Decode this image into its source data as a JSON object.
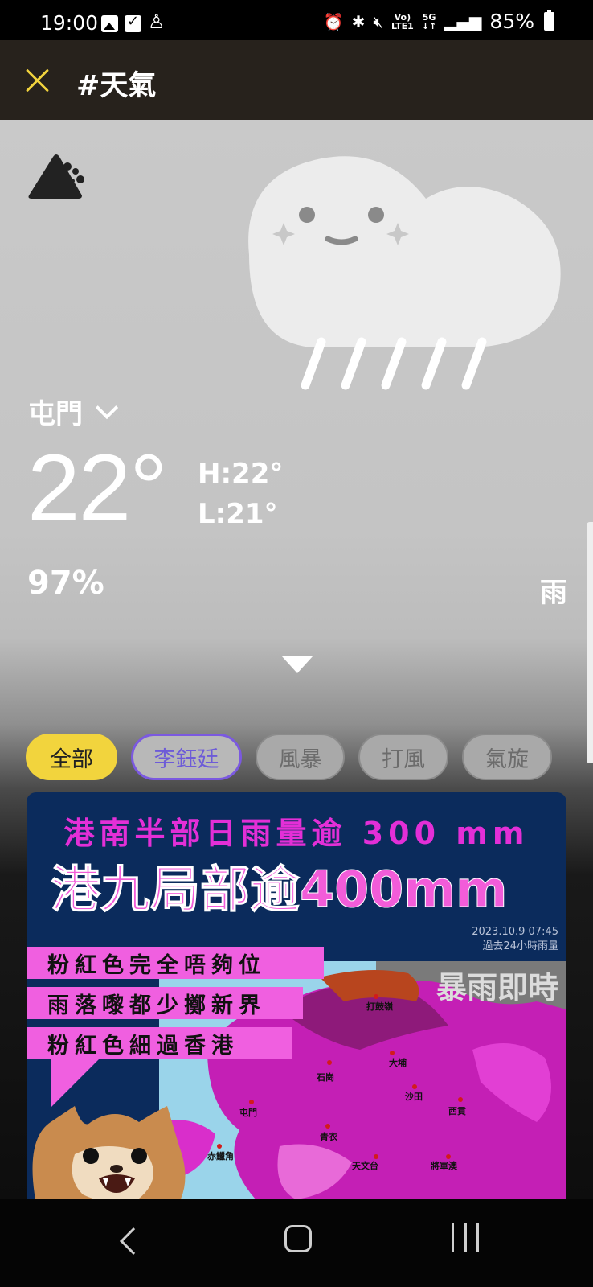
{
  "status_bar": {
    "time": "19:00",
    "lte_top": "Vo)",
    "lte_bottom": "LTE1",
    "net_top": "5G",
    "net_bottom": "↓↑",
    "battery": "85%"
  },
  "header": {
    "title": "#天氣"
  },
  "weather": {
    "location": "屯門",
    "temperature": "22°",
    "high": "H:22°",
    "low": "L:21°",
    "humidity": "97%",
    "condition": "雨"
  },
  "tags": [
    {
      "label": "全部"
    },
    {
      "label": "李鈺廷"
    },
    {
      "label": "風暴"
    },
    {
      "label": "打風"
    },
    {
      "label": "氣旋"
    }
  ],
  "card": {
    "headline1": "港南半部日雨量逾 300 mm",
    "headline2": "港九局部逾400mm",
    "timestamp_line1": "2023.10.9 07:45",
    "timestamp_line2": "過去24小時雨量",
    "caption_lines": [
      "粉紅色完全唔夠位",
      "雨落嚟都少擲新界",
      "粉紅色細過香港"
    ],
    "map_title": "暴雨即時",
    "map_labels": [
      "打鼓嶺",
      "大埔",
      "石崗",
      "沙田",
      "屯門",
      "西貢",
      "赤鱲角",
      "青衣",
      "天文台",
      "將軍澳"
    ]
  },
  "colors": {
    "accent_yellow": "#f2d43d",
    "header_bg": "#27221c",
    "card_magenta": "#f05fe0"
  }
}
